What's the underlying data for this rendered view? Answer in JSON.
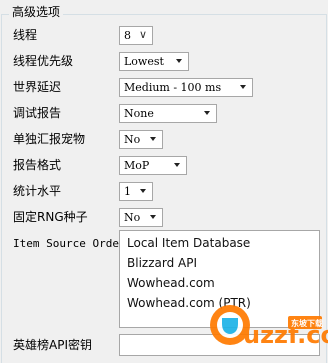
{
  "group": {
    "title": "高级选项"
  },
  "fields": [
    {
      "id": "threads",
      "label": "线程",
      "value": "8",
      "control": "chevron-down-icon"
    },
    {
      "id": "thread-priority",
      "label": "线程优先级",
      "value": "Lowest"
    },
    {
      "id": "world-lag",
      "label": "世界延迟",
      "value": "Medium - 100 ms"
    },
    {
      "id": "debug-report",
      "label": "调试报告",
      "value": "None"
    },
    {
      "id": "report-pets",
      "label": "单独汇报宠物",
      "value": "No"
    },
    {
      "id": "report-format",
      "label": "报告格式",
      "value": "MoP"
    },
    {
      "id": "stat-level",
      "label": "统计水平",
      "value": "1"
    },
    {
      "id": "fixed-rng-seed",
      "label": "固定RNG种子",
      "value": "No"
    }
  ],
  "item_source": {
    "label": "Item Source Order",
    "options": [
      "Local Item Database",
      "Blizzard API",
      "Wowhead.com",
      "Wowhead.com (PTR)"
    ]
  },
  "armory_key": {
    "label": "英雄榜API密钥",
    "value": ""
  },
  "watermark": {
    "brand": "uzzf.com",
    "subtitle": "东坡下载"
  }
}
